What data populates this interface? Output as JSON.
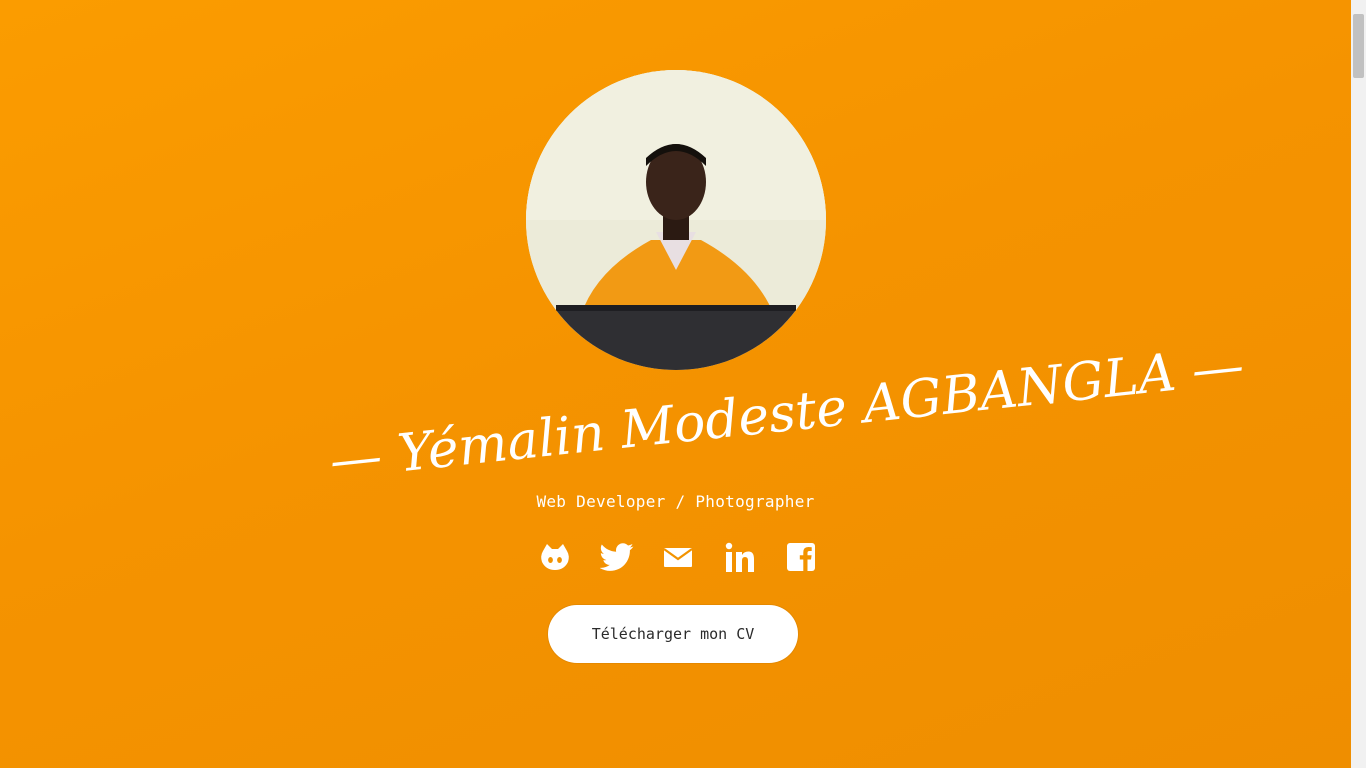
{
  "profile": {
    "photo_alt": "Portrait",
    "name": "— Yémalin Modeste AGBANGLA —",
    "role": "Web Developer / Photographer"
  },
  "socials": [
    {
      "icon": "github-icon"
    },
    {
      "icon": "twitter-icon"
    },
    {
      "icon": "email-icon"
    },
    {
      "icon": "linkedin-icon"
    },
    {
      "icon": "facebook-icon"
    }
  ],
  "cta": {
    "label": "Télécharger mon CV"
  },
  "colors": {
    "background": "#f59300",
    "text": "#ffffff",
    "button_bg": "#ffffff",
    "button_text": "#2b2b2b"
  }
}
